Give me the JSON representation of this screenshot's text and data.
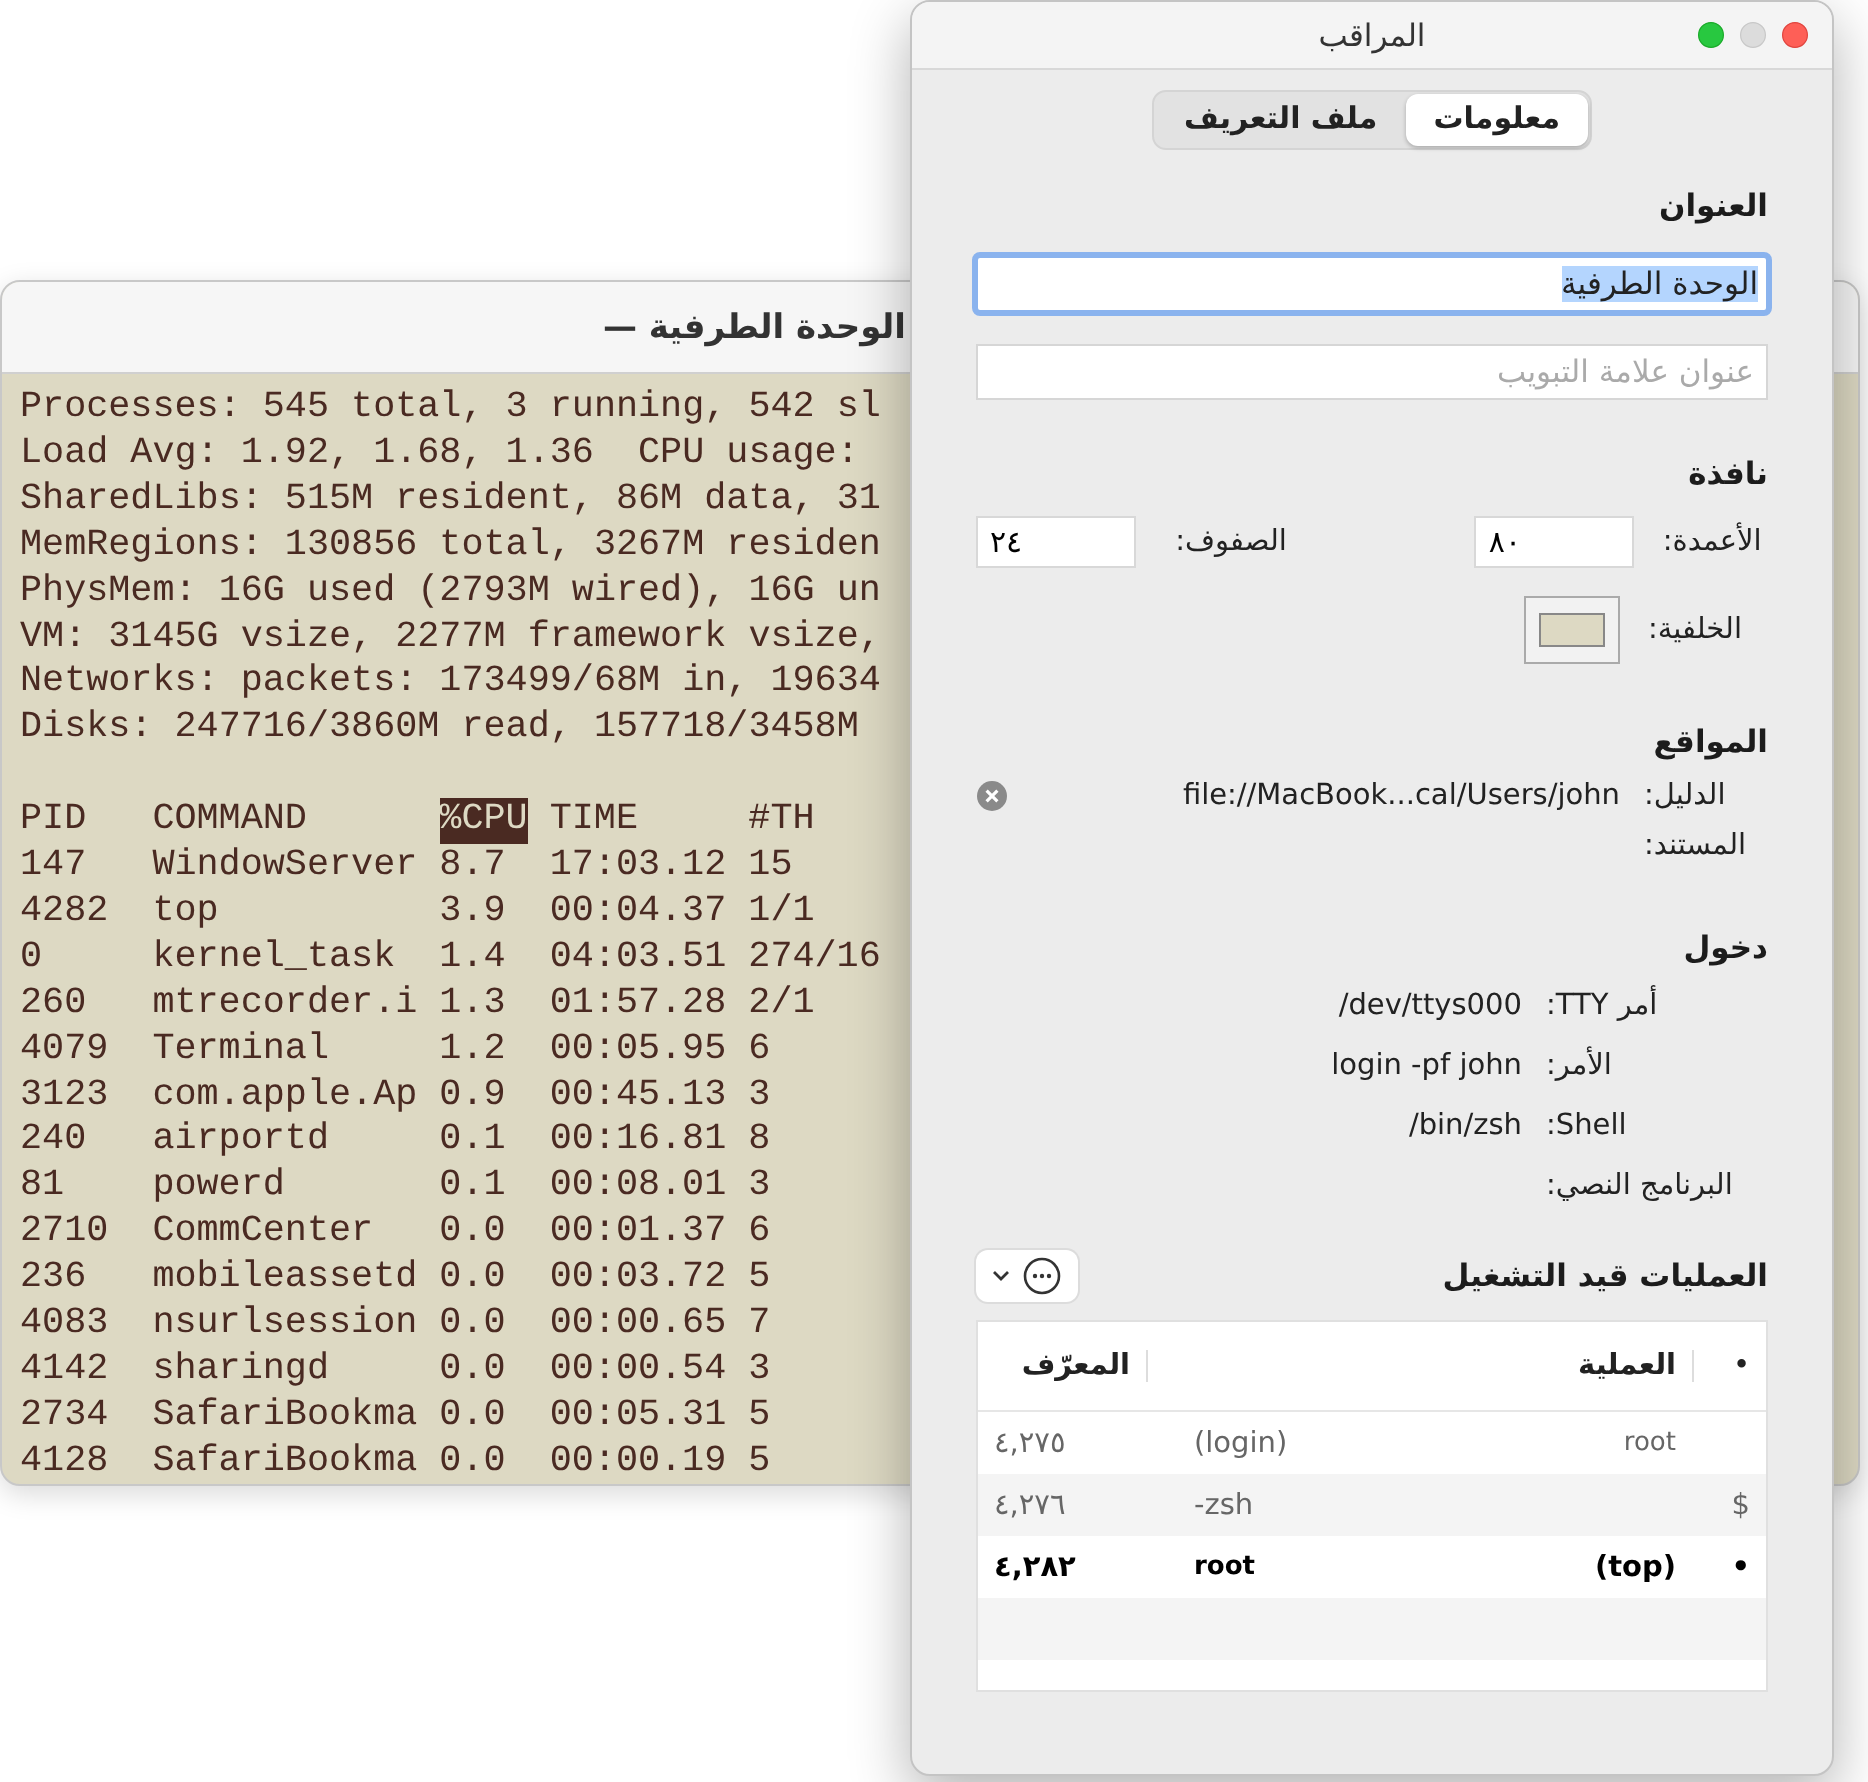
{
  "terminal_window": {
    "title": "الوحدة الطرفية —",
    "summary_lines": [
      "Processes: 545 total, 3 running, 542 sl",
      "Load Avg: 1.92, 1.68, 1.36  CPU usage:",
      "SharedLibs: 515M resident, 86M data, 31",
      "MemRegions: 130856 total, 3267M residen",
      "PhysMem: 16G used (2793M wired), 16G un",
      "VM: 3145G vsize, 2277M framework vsize,",
      "Networks: packets: 173499/68M in, 19634",
      "Disks: 247716/3860M read, 157718/3458M"
    ],
    "process_table": {
      "columns": [
        {
          "label": "PID",
          "selected": false
        },
        {
          "label": "COMMAND",
          "selected": false
        },
        {
          "label": "%CPU",
          "selected": true
        },
        {
          "label": "TIME",
          "selected": false
        },
        {
          "label": "#TH",
          "selected": false
        }
      ],
      "rows": [
        [
          "147",
          "WindowServer",
          "8.7",
          "17:03.12",
          "15"
        ],
        [
          "4282",
          "top",
          "3.9",
          "00:04.37",
          "1/1"
        ],
        [
          "0",
          "kernel_task",
          "1.4",
          "04:03.51",
          "274/16"
        ],
        [
          "260",
          "mtrecorder.i",
          "1.3",
          "01:57.28",
          "2/1"
        ],
        [
          "4079",
          "Terminal",
          "1.2",
          "00:05.95",
          "6"
        ],
        [
          "3123",
          "com.apple.Ap",
          "0.9",
          "00:45.13",
          "3"
        ],
        [
          "240",
          "airportd",
          "0.1",
          "00:16.81",
          "8"
        ],
        [
          "81",
          "powerd",
          "0.1",
          "00:08.01",
          "3"
        ],
        [
          "2710",
          "CommCenter",
          "0.0",
          "00:01.37",
          "6"
        ],
        [
          "236",
          "mobileassetd",
          "0.0",
          "00:03.72",
          "5"
        ],
        [
          "4083",
          "nsurlsession",
          "0.0",
          "00:00.65",
          "7"
        ],
        [
          "4142",
          "sharingd",
          "0.0",
          "00:00.54",
          "3"
        ],
        [
          "2734",
          "SafariBookma",
          "0.0",
          "00:05.31",
          "5"
        ],
        [
          "4128",
          "SafariBookma",
          "0.0",
          "00:00.19",
          "5"
        ]
      ]
    }
  },
  "inspector_window": {
    "title": "المراقب",
    "tabs": [
      {
        "label": "معلومات",
        "selected": true
      },
      {
        "label": "ملف التعريف",
        "selected": false
      }
    ],
    "title_section": {
      "heading": "العنوان",
      "title_field": {
        "value": "الوحدة الطرفية",
        "focused": true
      },
      "tab_title_field": {
        "placeholder": "عنوان علامة التبويب"
      }
    },
    "window_section": {
      "heading": "نافذة",
      "columns_label": "الأعمدة:",
      "columns_value": "٨٠",
      "rows_label": "الصفوف:",
      "rows_value": "٢٤",
      "background_label": "الخلفية:"
    },
    "locations_section": {
      "heading": "المواقع",
      "items": [
        {
          "label": "الدليل:",
          "value": "file://MacBook...cal/Users/john",
          "clearable": true
        },
        {
          "label": "المستند:"
        }
      ]
    },
    "login_section": {
      "heading": "دخول",
      "items": [
        {
          "label": "أمر TTY:",
          "value": "/dev/ttys000"
        },
        {
          "label": "الأمر:",
          "value": "login -pf john"
        },
        {
          "label": "Shell:",
          "value": "/bin/zsh"
        },
        {
          "label": "البرنامج النصي:"
        }
      ]
    },
    "processes_section": {
      "heading": "العمليات قيد التشغيل",
      "columns": [
        "•",
        "العملية",
        "المعرّف"
      ],
      "rows": [
        {
          "process_right": "root",
          "process_left": "(login)",
          "id": "٤,٢٧٥",
          "active": false
        },
        {
          "marker": "$",
          "process_left": "-zsh",
          "id": "٤,٢٧٦",
          "active": false
        },
        {
          "marker": "•",
          "process_right": "(top)",
          "process_left": "root",
          "id": "٤,٢٨٢",
          "active": true
        }
      ]
    }
  }
}
